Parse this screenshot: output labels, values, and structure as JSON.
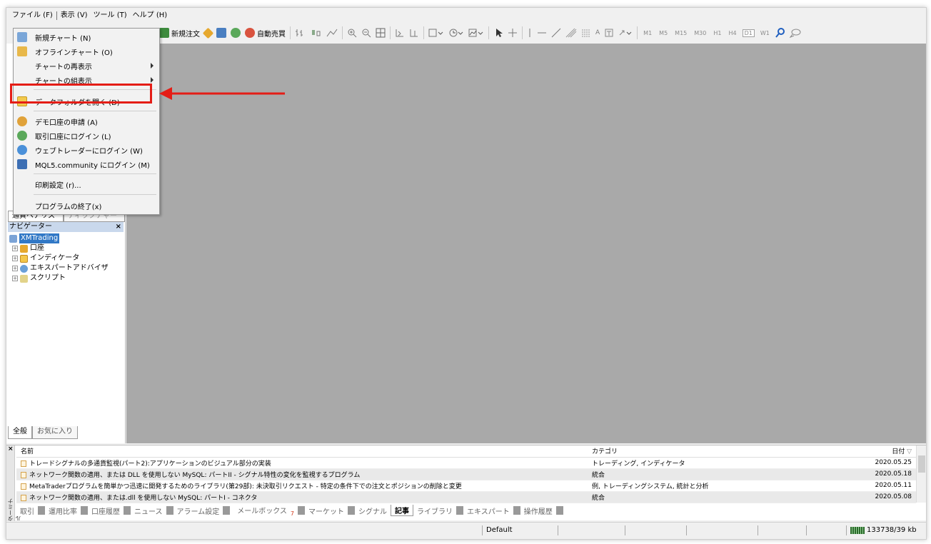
{
  "menubar": {
    "items": [
      "ファイル (F)",
      "表示 (V)",
      "ツール (T)",
      "ヘルプ (H)"
    ]
  },
  "toolbar": {
    "new_order": "新規注文",
    "auto_trading": "自動売買",
    "timeframes": [
      "M1",
      "M5",
      "M15",
      "M30",
      "H1",
      "H4",
      "D1",
      "W1"
    ],
    "active_timeframe": "D1",
    "text_tool": "A"
  },
  "file_menu": {
    "items": [
      {
        "label": "新規チャート (N)",
        "icon": "new-chart-icon"
      },
      {
        "label": "オフラインチャート (O)",
        "icon": "offline-chart-icon"
      },
      {
        "label": "チャートの再表示",
        "submenu": true
      },
      {
        "label": "チャートの組表示",
        "submenu": true
      },
      {
        "label": "データフォルダを開く (D)",
        "icon": "folder-icon",
        "highlighted": true
      },
      {
        "label": "デモ口座の申請 (A)",
        "icon": "demo-account-icon"
      },
      {
        "label": "取引口座にログイン (L)",
        "icon": "login-icon"
      },
      {
        "label": "ウェブトレーダーにログイン (W)",
        "icon": "webtrader-icon"
      },
      {
        "label": "MQL5.community にログイン (M)",
        "icon": "mql5-icon"
      },
      {
        "label": "印刷設定 (r)..."
      },
      {
        "label": "プログラムの終了(x)"
      }
    ]
  },
  "market_watch": {
    "tabs": [
      "通貨ペアリスト",
      "ティックチャート"
    ]
  },
  "navigator": {
    "title": "ナビゲーター",
    "close": "×",
    "root": "XMTrading",
    "nodes": [
      "口座",
      "インディケータ",
      "エキスパートアドバイザ",
      "スクリプト"
    ],
    "tabs": [
      "全般",
      "お気に入り"
    ]
  },
  "terminal": {
    "close": "×",
    "side_label": "ターミナル",
    "columns": {
      "name": "名前",
      "category": "カテゴリ",
      "date": "日付"
    },
    "rows": [
      {
        "name": "トレードシグナルの多通貨監視(パート2):アプリケーションのビジュアル部分の実装",
        "category": "トレーディング, インディケータ",
        "date": "2020.05.25"
      },
      {
        "name": "ネットワーク関数の適用、または DLL を使用しない MySQL: パートII - シグナル特性の変化を監視するプログラム",
        "category": "統合",
        "date": "2020.05.18"
      },
      {
        "name": "MetaTraderプログラムを簡単かつ迅速に開発するためのライブラリ(第29部): 未決取引リクエスト - 特定の条件下での注文とポジションの削除と変更",
        "category": "例, トレーディングシステム, 統計と分析",
        "date": "2020.05.11"
      },
      {
        "name": "ネットワーク関数の適用、または.dll を使用しない MySQL: パートI - コネクタ",
        "category": "統合",
        "date": "2020.05.08"
      }
    ],
    "tabs": [
      "取引",
      "運用比率",
      "口座履歴",
      "ニュース",
      "アラーム設定",
      "メールボックス",
      "マーケット",
      "シグナル",
      "記事",
      "ライブラリ",
      "エキスパート",
      "操作履歴"
    ],
    "mailbox_badge": "7",
    "active_tab": "記事"
  },
  "statusbar": {
    "profile": "Default",
    "memory": "133738/39 kb"
  },
  "colors": {
    "highlight": "#e41d16",
    "chart_bg": "#a9a9a9",
    "selected": "#3178c6"
  }
}
